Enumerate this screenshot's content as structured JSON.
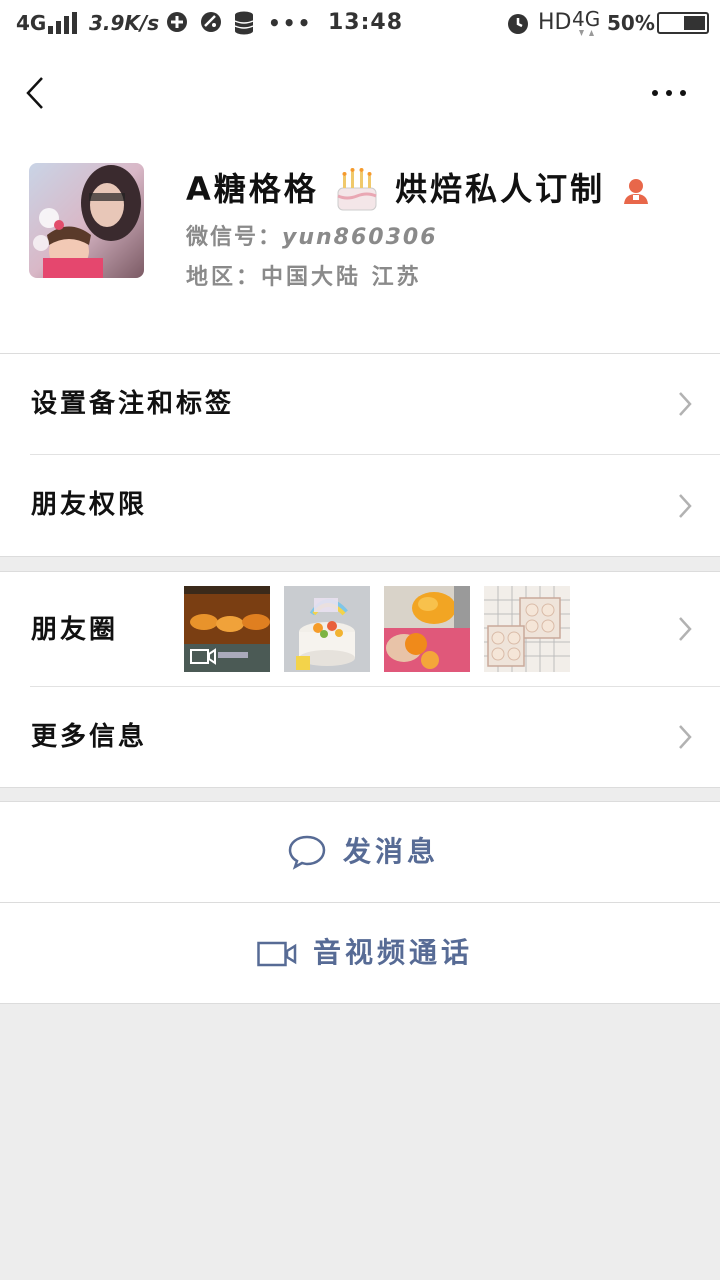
{
  "status_bar": {
    "network_left": "4G",
    "speed": "3.9K/s",
    "dots": "•••",
    "time": "13:48",
    "hd": "HD",
    "network_right": "4G",
    "battery": "50%"
  },
  "nav": {
    "back_icon": "chevron-left-icon",
    "more_icon": "more-horizontal-icon"
  },
  "profile": {
    "name_part1": "A糖格格",
    "cake_emoji": "🎂",
    "name_part2": "烘焙私人订制",
    "wechat_id_label": "微信号：",
    "wechat_id": "yun860306",
    "region_label": "地区：",
    "region": "中国大陆 江苏"
  },
  "menu": {
    "remarks_tags": "设置备注和标签",
    "friend_permissions": "朋友权限",
    "moments": "朋友圈",
    "more_info": "更多信息"
  },
  "actions": {
    "send_message": "发消息",
    "video_call": "音视频通话"
  },
  "colors": {
    "link_blue": "#576b95",
    "background": "#ededed"
  }
}
